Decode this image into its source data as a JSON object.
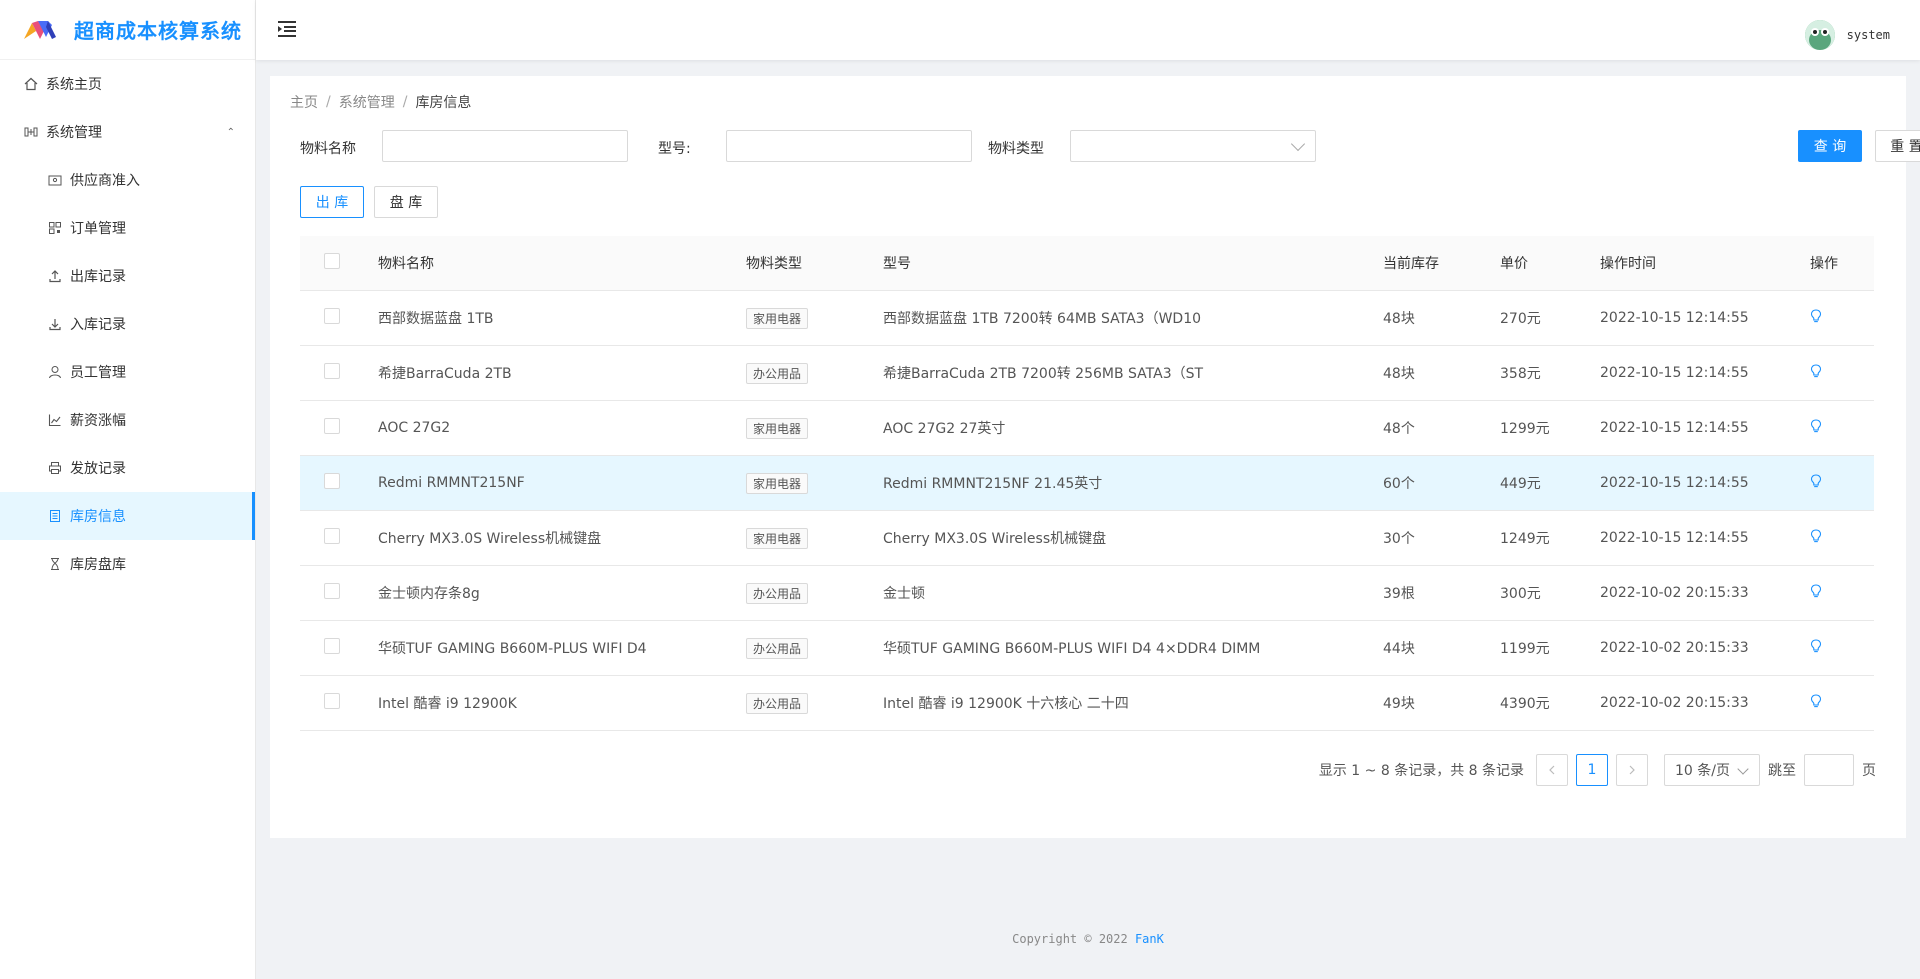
{
  "app": {
    "title": "超商成本核算系统"
  },
  "header": {
    "username": "system"
  },
  "sidebar": {
    "items": [
      {
        "label": "系统主页",
        "icon": "home-icon"
      },
      {
        "label": "系统管理",
        "icon": "tools-icon"
      },
      {
        "label": "供应商准入",
        "icon": "id-card-icon"
      },
      {
        "label": "订单管理",
        "icon": "qrcode-icon"
      },
      {
        "label": "出库记录",
        "icon": "upload-icon"
      },
      {
        "label": "入库记录",
        "icon": "download-icon"
      },
      {
        "label": "员工管理",
        "icon": "user-icon"
      },
      {
        "label": "薪资涨幅",
        "icon": "line-chart-icon"
      },
      {
        "label": "发放记录",
        "icon": "printer-icon"
      },
      {
        "label": "库房信息",
        "icon": "file-text-icon"
      },
      {
        "label": "库房盘库",
        "icon": "hourglass-icon"
      }
    ]
  },
  "breadcrumb": [
    "主页",
    "系统管理",
    "库房信息"
  ],
  "filter": {
    "name_label": "物料名称",
    "model_label": "型号:",
    "type_label": "物料类型",
    "query_label": "查 询",
    "reset_label": "重 置"
  },
  "actions": {
    "out_label": "出 库",
    "check_label": "盘 库"
  },
  "table": {
    "headers": [
      "物料名称",
      "物料类型",
      "型号",
      "当前库存",
      "单价",
      "操作时间",
      "操作"
    ],
    "rows": [
      {
        "name": "西部数据蓝盘 1TB",
        "type": "家用电器",
        "model": "西部数据蓝盘 1TB 7200转 64MB SATA3（WD10",
        "stock": "48块",
        "price": "270元",
        "time": "2022-10-15 12:14:55"
      },
      {
        "name": "希捷BarraCuda 2TB",
        "type": "办公用品",
        "model": "希捷BarraCuda 2TB 7200转 256MB SATA3（ST",
        "stock": "48块",
        "price": "358元",
        "time": "2022-10-15 12:14:55"
      },
      {
        "name": "AOC 27G2",
        "type": "家用电器",
        "model": "AOC 27G2 27英寸",
        "stock": "48个",
        "price": "1299元",
        "time": "2022-10-15 12:14:55"
      },
      {
        "name": "Redmi RMMNT215NF",
        "type": "家用电器",
        "model": "Redmi RMMNT215NF 21.45英寸",
        "stock": "60个",
        "price": "449元",
        "time": "2022-10-15 12:14:55"
      },
      {
        "name": "Cherry MX3.0S Wireless机械键盘",
        "type": "家用电器",
        "model": "Cherry MX3.0S Wireless机械键盘",
        "stock": "30个",
        "price": "1249元",
        "time": "2022-10-15 12:14:55"
      },
      {
        "name": "金士顿内存条8g",
        "type": "办公用品",
        "model": "金士顿",
        "stock": "39根",
        "price": "300元",
        "time": "2022-10-02 20:15:33"
      },
      {
        "name": "华硕TUF GAMING B660M-PLUS WIFI D4",
        "type": "办公用品",
        "model": "华硕TUF GAMING B660M-PLUS WIFI D4 4×DDR4 DIMM",
        "stock": "44块",
        "price": "1199元",
        "time": "2022-10-02 20:15:33"
      },
      {
        "name": "Intel 酷睿 i9 12900K",
        "type": "办公用品",
        "model": "Intel 酷睿 i9 12900K 十六核心 二十四",
        "stock": "49块",
        "price": "4390元",
        "time": "2022-10-02 20:15:33"
      }
    ]
  },
  "pagination": {
    "total_text": "显示 1 ~ 8 条记录，共 8 条记录",
    "current_page": "1",
    "page_size": "10 条/页",
    "jump_label": "跳至",
    "page_suffix": "页"
  },
  "footer": {
    "text": "Copyright © 2022",
    "author": "FanK"
  },
  "colors": {
    "primary": "#1890ff",
    "hover_row": "#e6f7ff"
  }
}
